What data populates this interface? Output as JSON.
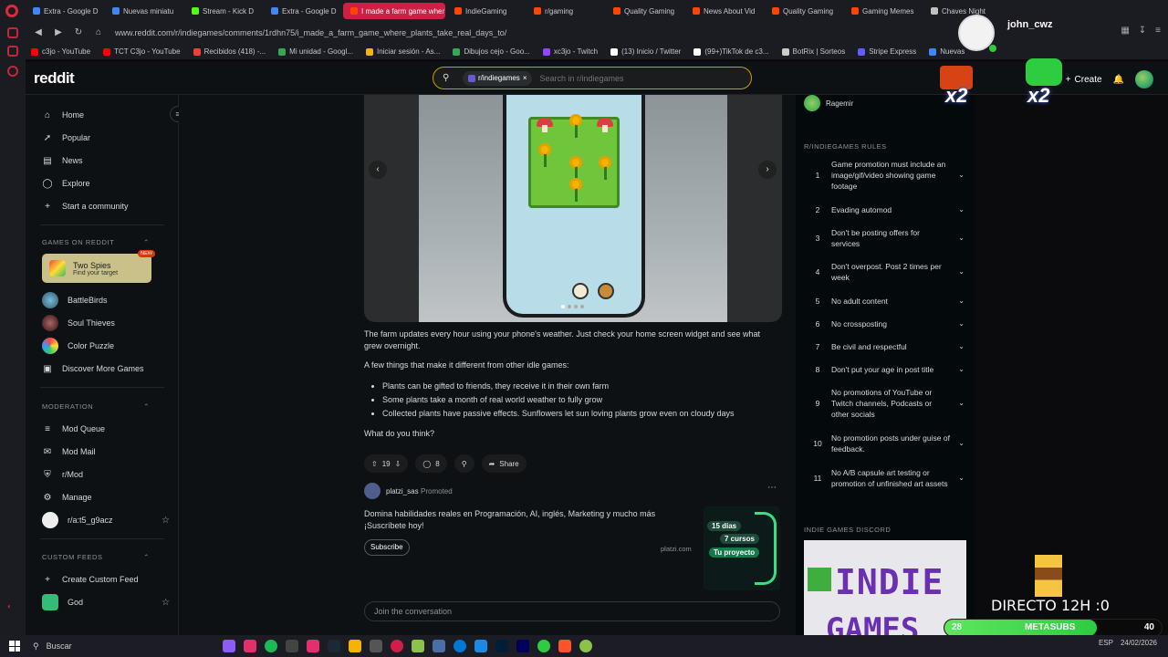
{
  "browser": {
    "tabs": [
      {
        "label": "Extra - Google D",
        "color": "#4285f4"
      },
      {
        "label": "Nuevas miniatu",
        "color": "#4285f4"
      },
      {
        "label": "Stream - Kick D",
        "color": "#53fc18"
      },
      {
        "label": "Extra - Google D",
        "color": "#4285f4"
      },
      {
        "label": "I made a farm game wher",
        "color": "#ff4500"
      },
      {
        "label": "IndieGaming",
        "color": "#ff4500"
      },
      {
        "label": "r/gaming",
        "color": "#ff4500"
      },
      {
        "label": "Quality Gaming",
        "color": "#ff4500"
      },
      {
        "label": "News About Vid",
        "color": "#ff4500"
      },
      {
        "label": "Quality Gaming",
        "color": "#ff4500"
      },
      {
        "label": "Gaming Memes",
        "color": "#ff4500"
      },
      {
        "label": "Chaves Night",
        "color": "#c0c0c0"
      }
    ],
    "url": "www.reddit.com/r/indiegames/comments/1rdhn75/i_made_a_farm_game_where_plants_take_real_days_to/",
    "bookmarks": [
      {
        "label": "c3jo - YouTube",
        "color": "#ff0000"
      },
      {
        "label": "TCT C3jo - YouTube",
        "color": "#ff0000"
      },
      {
        "label": "Recibidos (418) -...",
        "color": "#ea4335"
      },
      {
        "label": "Mi unidad - Googl...",
        "color": "#34a853"
      },
      {
        "label": "Iniciar sesión - As...",
        "color": "#f4b400"
      },
      {
        "label": "Dibujos cejo - Goo...",
        "color": "#34a853"
      },
      {
        "label": "xc3jo - Twitch",
        "color": "#9146ff"
      },
      {
        "label": "(13) Inicio / Twitter",
        "color": "#ffffff"
      },
      {
        "label": "(99+)TikTok de c3...",
        "color": "#ffffff"
      },
      {
        "label": "BotRix | Sorteos",
        "color": "#cccccc"
      },
      {
        "label": "Stripe Express",
        "color": "#635bff"
      },
      {
        "label": "Nuevas",
        "color": "#4285f4"
      }
    ]
  },
  "reddit": {
    "logo": "reddit",
    "search": {
      "chip": "r/indiegames",
      "placeholder": "Search in r/indiegames"
    },
    "create_label": "Create",
    "notif_count": "2"
  },
  "leftnav": {
    "main": [
      {
        "label": "Home",
        "icon": "home-icon"
      },
      {
        "label": "Popular",
        "icon": "popular-icon"
      },
      {
        "label": "News",
        "icon": "news-icon"
      },
      {
        "label": "Explore",
        "icon": "explore-icon"
      },
      {
        "label": "Start a community",
        "icon": "plus-icon"
      }
    ],
    "games_header": "GAMES ON REDDIT",
    "promo": {
      "title": "Two Spies",
      "subtitle": "Find your target",
      "badge": "NEW"
    },
    "games": [
      "BattleBirds",
      "Soul Thieves",
      "Color Puzzle",
      "Discover More Games"
    ],
    "moderation_header": "MODERATION",
    "moderation": [
      "Mod Queue",
      "Mod Mail",
      "r/Mod",
      "Manage",
      "r/a:t5_g9acz"
    ],
    "custom_header": "CUSTOM FEEDS",
    "custom": [
      "Create Custom Feed",
      "God"
    ]
  },
  "post": {
    "para1": "The farm updates every hour using your phone's weather. Just check your home screen widget and see what grew overnight.",
    "para2": "A few things that make it different from other idle games:",
    "bullets": [
      "Plants can be gifted to friends, they receive it in their own farm",
      "Some plants take a month of real world weather to fully grow",
      "Collected plants have passive effects. Sunflowers let sun loving plants grow even on cloudy days"
    ],
    "para3": "What do you think?",
    "votes": "19",
    "comments": "8",
    "share": "Share"
  },
  "ad": {
    "user": "platzi_sas",
    "promoted": "Promoted",
    "text": "Domina habilidades reales en Programación, AI, inglés, Marketing y mucho más ¡Suscríbete hoy!",
    "button": "Subscribe",
    "domain": "platzi.com",
    "image_badges": [
      "15 días",
      "7 cursos",
      "Tu proyecto"
    ]
  },
  "join_placeholder": "Join the conversation",
  "sidebar": {
    "moderator": "Ragemir",
    "rules_title": "R/INDIEGAMES RULES",
    "rules": [
      {
        "num": "1",
        "text": "Game promotion must include an image/gif/video showing game footage"
      },
      {
        "num": "2",
        "text": "Evading automod"
      },
      {
        "num": "3",
        "text": "Don't be posting offers for services"
      },
      {
        "num": "4",
        "text": "Don't overpost. Post 2 times per week"
      },
      {
        "num": "5",
        "text": "No adult content"
      },
      {
        "num": "6",
        "text": "No crossposting"
      },
      {
        "num": "7",
        "text": "Be civil and respectful"
      },
      {
        "num": "8",
        "text": "Don't put your age in post title"
      },
      {
        "num": "9",
        "text": "No promotions of YouTube or Twitch channels, Podcasts or other socials"
      },
      {
        "num": "10",
        "text": "No promotion posts under guise of feedback."
      },
      {
        "num": "11",
        "text": "No A/B capsule art testing or promotion of unfinished art assets"
      }
    ],
    "discord_title": "INDIE GAMES DISCORD",
    "banner_line1": "INDIE",
    "banner_line2": "GAMES"
  },
  "overlay": {
    "username": "john_cwz",
    "multiplier": "x2",
    "directo": "DIRECTO 12H :0",
    "bar_left": "28",
    "bar_mid": "METASUBS",
    "bar_right": "40",
    "bar_fraction": 0.7
  },
  "taskbar": {
    "search": "Buscar",
    "lang": "ESP",
    "date": "24/02/2026"
  }
}
